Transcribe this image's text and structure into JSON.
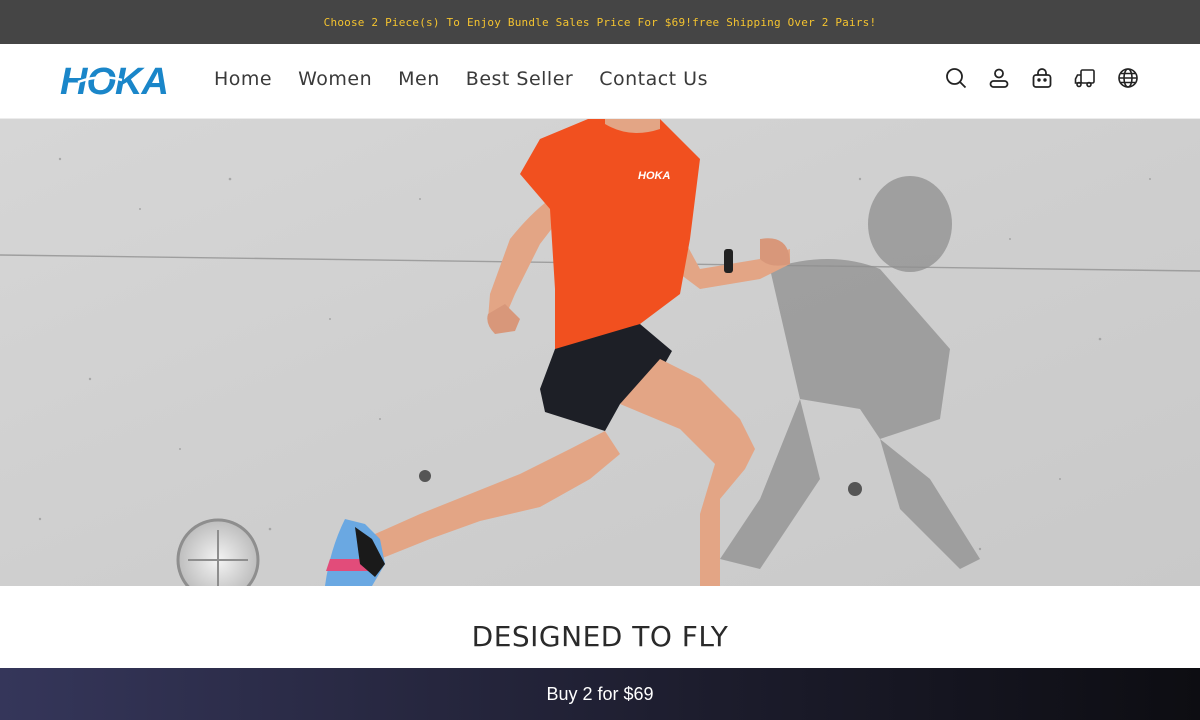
{
  "announcement": {
    "text": "Choose 2 Piece(s) To Enjoy Bundle Sales Price For $69!free Shipping Over 2 Pairs!"
  },
  "header": {
    "logo_text": "HOKA",
    "nav": [
      {
        "label": "Home"
      },
      {
        "label": "Women"
      },
      {
        "label": "Men"
      },
      {
        "label": "Best Seller"
      },
      {
        "label": "Contact Us"
      }
    ],
    "icons": [
      "search-icon",
      "account-icon",
      "cart-icon",
      "shipping-truck-icon",
      "globe-icon"
    ]
  },
  "hero": {
    "shirt_logo": "HOKA"
  },
  "section": {
    "title": "DESIGNED TO FLY"
  },
  "bundle_bar": {
    "label": "Buy 2 for $69"
  },
  "colors": {
    "announcement_bg": "#454545",
    "announcement_text": "#f4c32f",
    "brand_blue": "#1a86c9",
    "shirt_orange": "#f1501f",
    "bundle_bar_dark": "#1c1c2c"
  }
}
